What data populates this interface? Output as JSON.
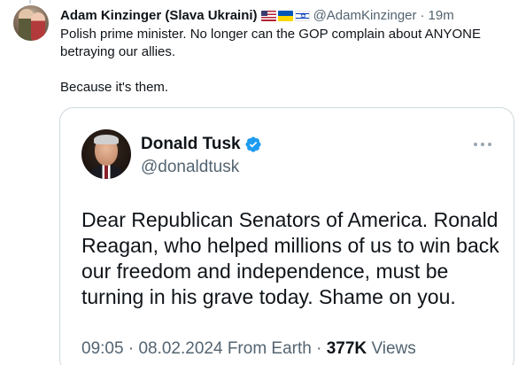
{
  "tweet": {
    "author_name": "Adam Kinzinger (Slava Ukraini)",
    "flags": [
      "us-flag-icon",
      "ukraine-flag-icon",
      "israel-flag-icon"
    ],
    "author_handle": "@AdamKinzinger",
    "separator": "·",
    "time": "19m",
    "text_line1": "Polish prime minister.  No longer can the GOP complain about ANYONE betraying our allies.",
    "text_line2": "Because it's them."
  },
  "quote": {
    "name": "Donald Tusk",
    "verified": "verified-badge-icon",
    "handle": "@donaldtusk",
    "more": "more-options-icon",
    "text": "Dear Republican Senators of America. Ronald Reagan, who helped millions of us to win back our freedom and independence, must be turning in his grave today. Shame on you.",
    "time": "09:05",
    "sep1": "·",
    "date": "08.02.2024",
    "location": "From Earth",
    "sep2": "·",
    "views_count": "377K",
    "views_label": "Views"
  },
  "colors": {
    "text": "#0f1419",
    "secondary": "#536471",
    "border": "#cfd9de",
    "verified": "#1d9bf0"
  }
}
